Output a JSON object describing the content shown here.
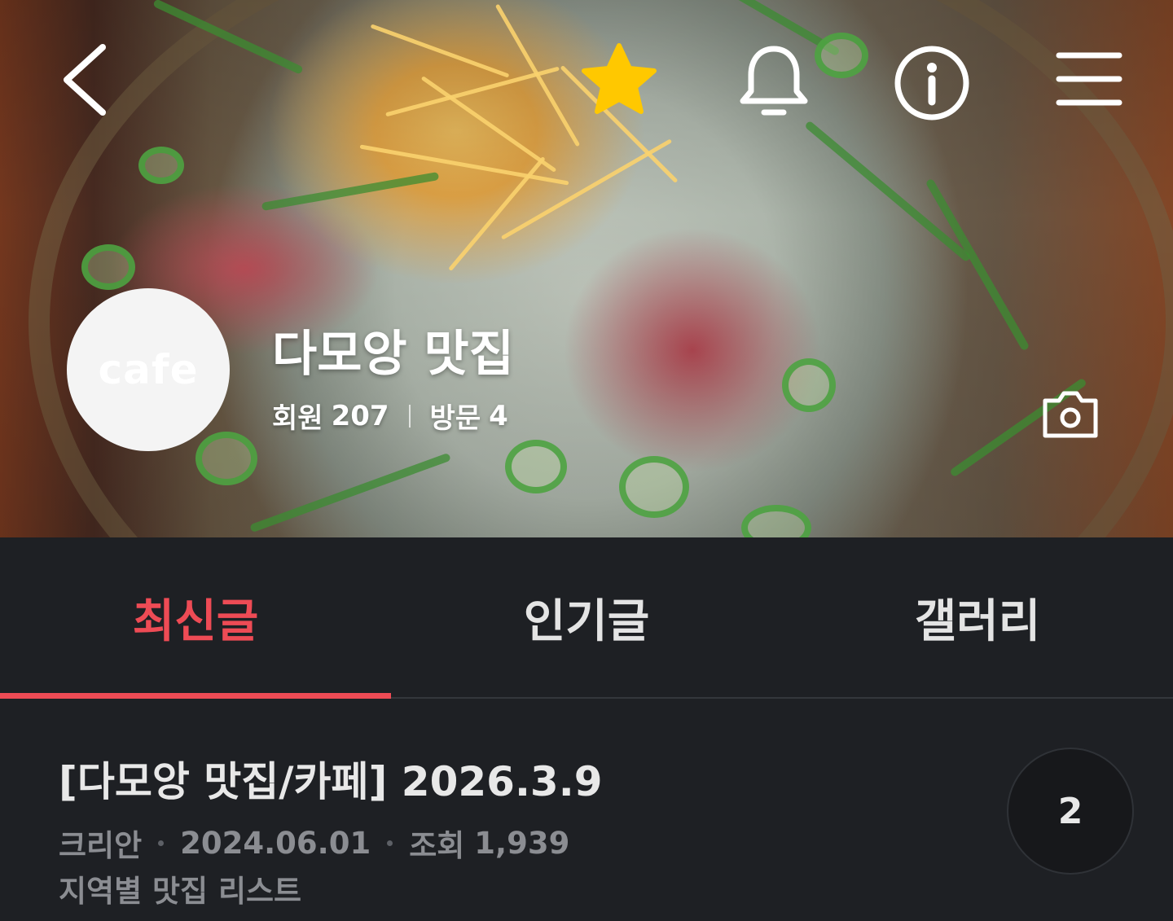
{
  "header": {
    "cafe_name": "다모앙 맛집",
    "avatar_text": "cafe",
    "members_label": "회원",
    "members_count": "207",
    "visits_label": "방문",
    "visits_count": "4",
    "favorite_color": "#ffc800",
    "icons": [
      "back-arrow-icon",
      "star-icon",
      "bell-icon",
      "info-icon",
      "hamburger-menu-icon",
      "camera-icon"
    ]
  },
  "tabs": [
    {
      "label": "최신글",
      "active": true
    },
    {
      "label": "인기글",
      "active": false
    },
    {
      "label": "갤러리",
      "active": false
    }
  ],
  "accent_color": "#ee4b55",
  "post": {
    "title": "[다모앙 맛집/카페] 2026.3.9",
    "author": "크리안",
    "date": "2024.06.01",
    "views_label": "조회",
    "views_count": "1,939",
    "board": "지역별 맛집 리스트",
    "comment_count": "2"
  }
}
